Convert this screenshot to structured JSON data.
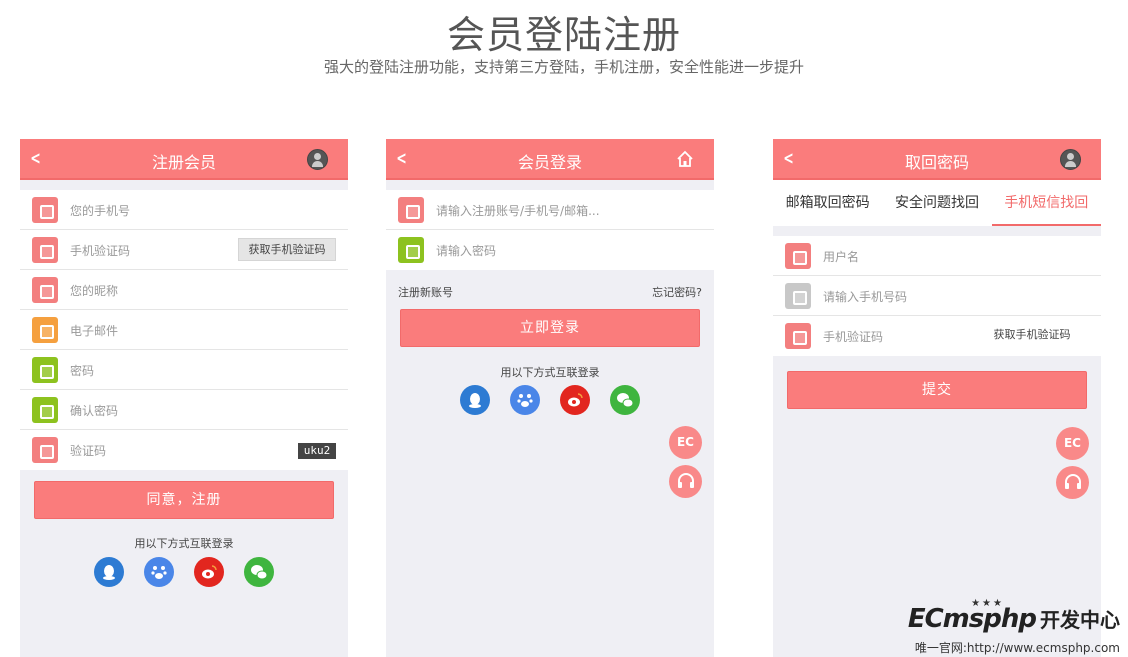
{
  "header": {
    "title": "会员登陆注册",
    "subtitle": "强大的登陆注册功能，支持第三方登陆，手机注册，安全性能进一步提升"
  },
  "register": {
    "title": "注册会员",
    "fields": [
      {
        "placeholder": "您的手机号"
      },
      {
        "placeholder": "手机验证码",
        "action": "获取手机验证码"
      },
      {
        "placeholder": "您的昵称"
      },
      {
        "placeholder": "电子邮件"
      },
      {
        "placeholder": "密码"
      },
      {
        "placeholder": "确认密码"
      },
      {
        "placeholder": "验证码",
        "captcha": "uku2"
      }
    ],
    "submit": "同意，注册",
    "social_tip": "用以下方式互联登录"
  },
  "login": {
    "title": "会员登录",
    "fields": [
      {
        "placeholder": "请输入注册账号/手机号/邮箱..."
      },
      {
        "placeholder": "请输入密码"
      }
    ],
    "register_link": "注册新账号",
    "forgot_link": "忘记密码?",
    "submit": "立即登录",
    "social_tip": "用以下方式互联登录",
    "fab_ec": "EC"
  },
  "recover": {
    "title": "取回密码",
    "tabs": [
      "邮箱取回密码",
      "安全问题找回",
      "手机短信找回"
    ],
    "active_tab": 2,
    "fields": [
      {
        "placeholder": "用户名"
      },
      {
        "placeholder": "请输入手机号码"
      },
      {
        "placeholder": "手机验证码",
        "action": "获取手机验证码"
      }
    ],
    "submit": "提交",
    "fab_ec": "EC"
  },
  "brand": {
    "logo": "ECmsphp",
    "logo_cn": "开发中心",
    "url": "唯一官网:http://www.ecmsphp.com"
  },
  "colors": {
    "accent": "#fa7c7c",
    "qq": "#2d7bd3",
    "baidu": "#4a86e8",
    "weibo": "#e2261f",
    "wechat": "#3fb53f"
  }
}
